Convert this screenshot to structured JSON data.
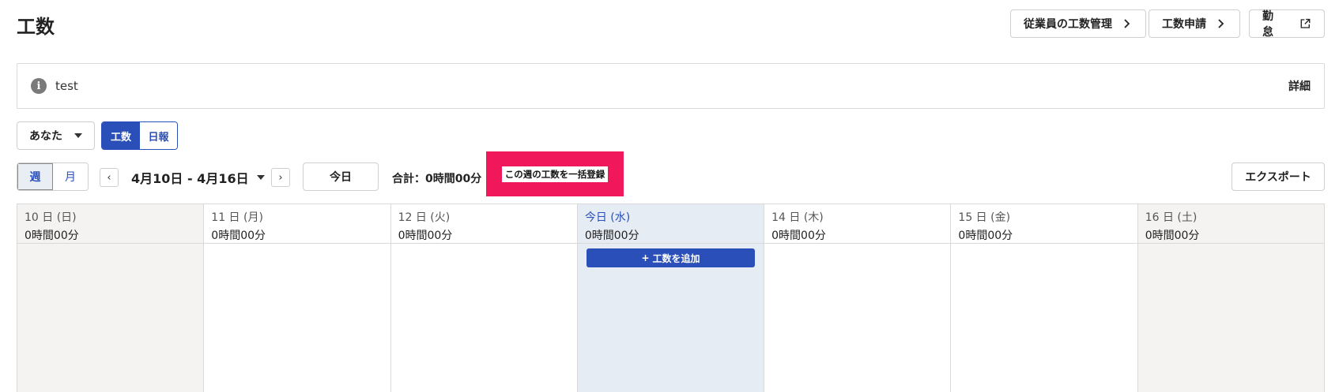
{
  "page": {
    "title": "工数"
  },
  "header": {
    "employee_manage": "従業員の工数管理",
    "application": "工数申請",
    "attendance": "勤怠"
  },
  "info": {
    "text": "test",
    "detail": "詳細",
    "icon": "info-icon"
  },
  "filters": {
    "user": "あなた",
    "view_tabs": [
      "工数",
      "日報"
    ],
    "period_tabs": [
      "週",
      "月"
    ],
    "range": "4月10日 - 4月16日",
    "today": "今日",
    "total": "合計：0時間00分",
    "bulk_register": "この週の工数を一括登録",
    "export": "エクスポート"
  },
  "calendar": {
    "days": [
      {
        "date": "10 日 (日)",
        "total": "0時間00分"
      },
      {
        "date": "11 日 (月)",
        "total": "0時間00分"
      },
      {
        "date": "12 日 (火)",
        "total": "0時間00分"
      },
      {
        "date": "今日 (水)",
        "total": "0時間00分"
      },
      {
        "date": "14 日 (木)",
        "total": "0時間00分"
      },
      {
        "date": "15 日 (金)",
        "total": "0時間00分"
      },
      {
        "date": "16 日 (土)",
        "total": "0時間00分"
      }
    ],
    "add_label": "工数を追加"
  },
  "colors": {
    "accent": "#2a4fb8",
    "highlight": "#f0185a",
    "weekend_bg": "#f4f3f1",
    "today_bg": "#e6ecf4"
  }
}
